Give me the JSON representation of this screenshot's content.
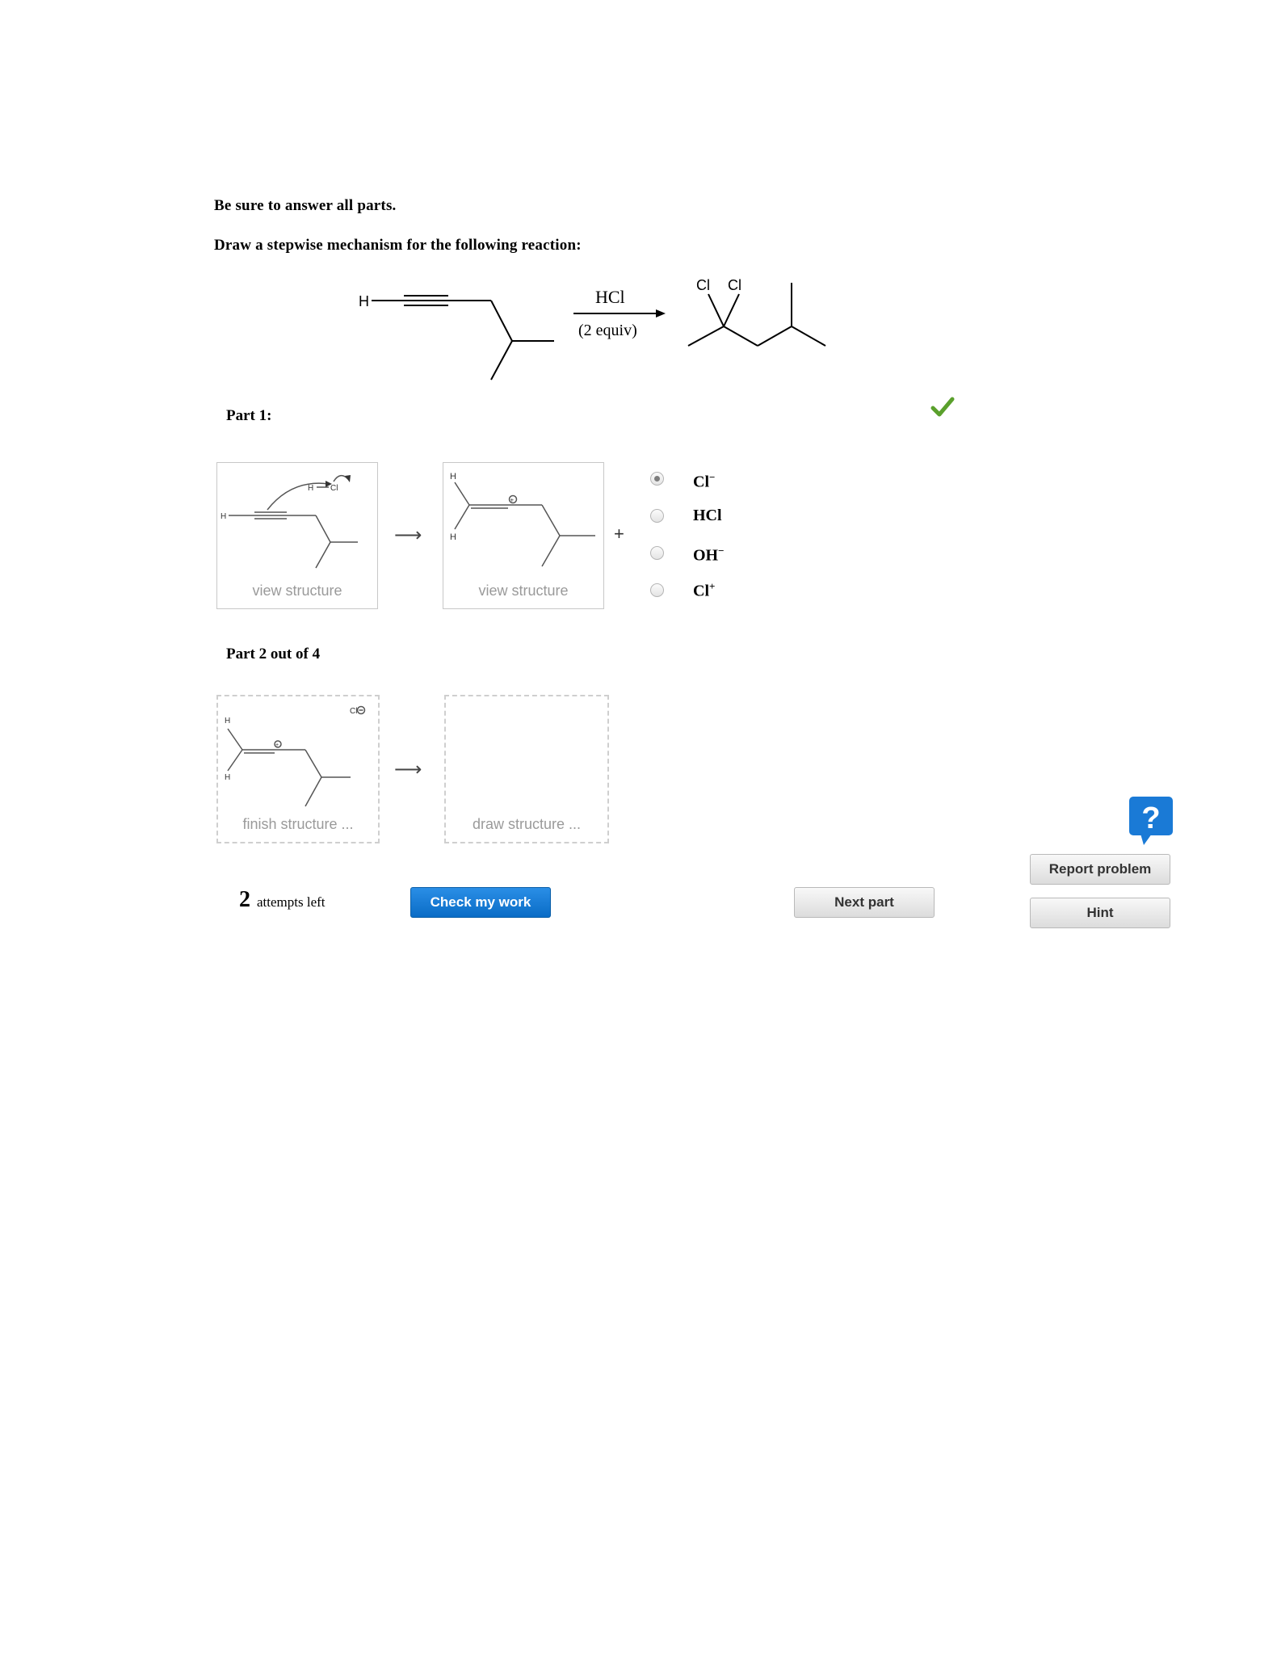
{
  "instructions": {
    "line1": "Be sure to answer all parts.",
    "line2": "Draw a stepwise mechanism for the following reaction:"
  },
  "reaction": {
    "reagent": "HCl",
    "reagent_amount": "(2 equiv)",
    "reactant_h": "H",
    "product_cl_1": "Cl",
    "product_cl_2": "Cl"
  },
  "part1": {
    "title": "Part 1:",
    "status_icon": "checkmark-icon",
    "status_color": "#5aa02c",
    "box1_label": "view structure",
    "box2_label": "view structure",
    "box1_atoms": {
      "h_left": "H",
      "h_top": "H",
      "cl": "Cl"
    },
    "box2_atoms": {
      "h_top": "H",
      "h_bottom": "H",
      "charge": "+"
    },
    "arrow": "⟶",
    "plus": "+",
    "options": [
      {
        "label": "Cl",
        "sup": "−",
        "selected": true
      },
      {
        "label": "HCl",
        "sup": "",
        "selected": false
      },
      {
        "label": "OH",
        "sup": "−",
        "selected": false
      },
      {
        "label": "Cl",
        "sup": "+",
        "selected": false
      }
    ]
  },
  "part2": {
    "title": "Part 2 out of 4",
    "box1_label": "finish structure ...",
    "box2_label": "draw structure ...",
    "box1_atoms": {
      "cl_ion": "Cl",
      "h_top": "H",
      "h_bottom": "H",
      "charge": "+"
    },
    "arrow": "⟶"
  },
  "footer": {
    "attempts_count": "2",
    "attempts_text": "attempts left",
    "check_button": "Check my work",
    "next_button": "Next part",
    "report_button": "Report problem",
    "hint_button": "Hint",
    "help_icon": "question-help-icon",
    "help_glyph": "?",
    "accent_color": "#1a7ad6"
  }
}
